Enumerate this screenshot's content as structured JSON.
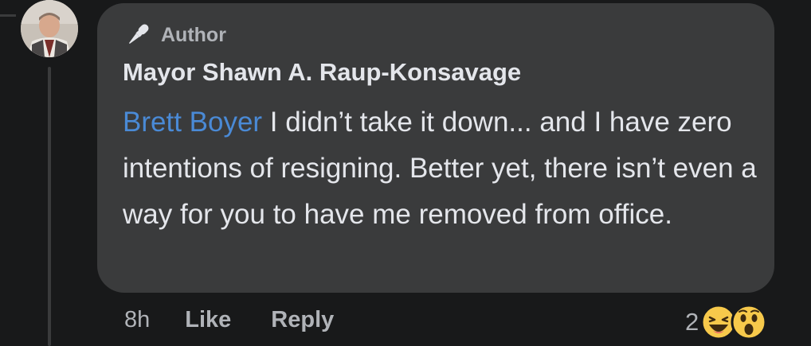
{
  "comment": {
    "author_badge": "Author",
    "author_name": "Mayor Shawn A. Raup-Konsavage",
    "mention": "Brett Boyer",
    "text": " I didn’t take it down... and I have zero intentions of resigning. Better yet, there isn’t even a way for you to have me removed from office.",
    "timestamp": "8h",
    "like_label": "Like",
    "reply_label": "Reply",
    "reaction_count": "2",
    "reactions": [
      "haha-icon",
      "wow-icon"
    ]
  },
  "colors": {
    "background": "#18191a",
    "bubble": "#3a3b3c",
    "text": "#e4e6eb",
    "muted": "#b0b3b8",
    "mention": "#4a8ad6",
    "reaction_yellow": "#f7c94b"
  }
}
